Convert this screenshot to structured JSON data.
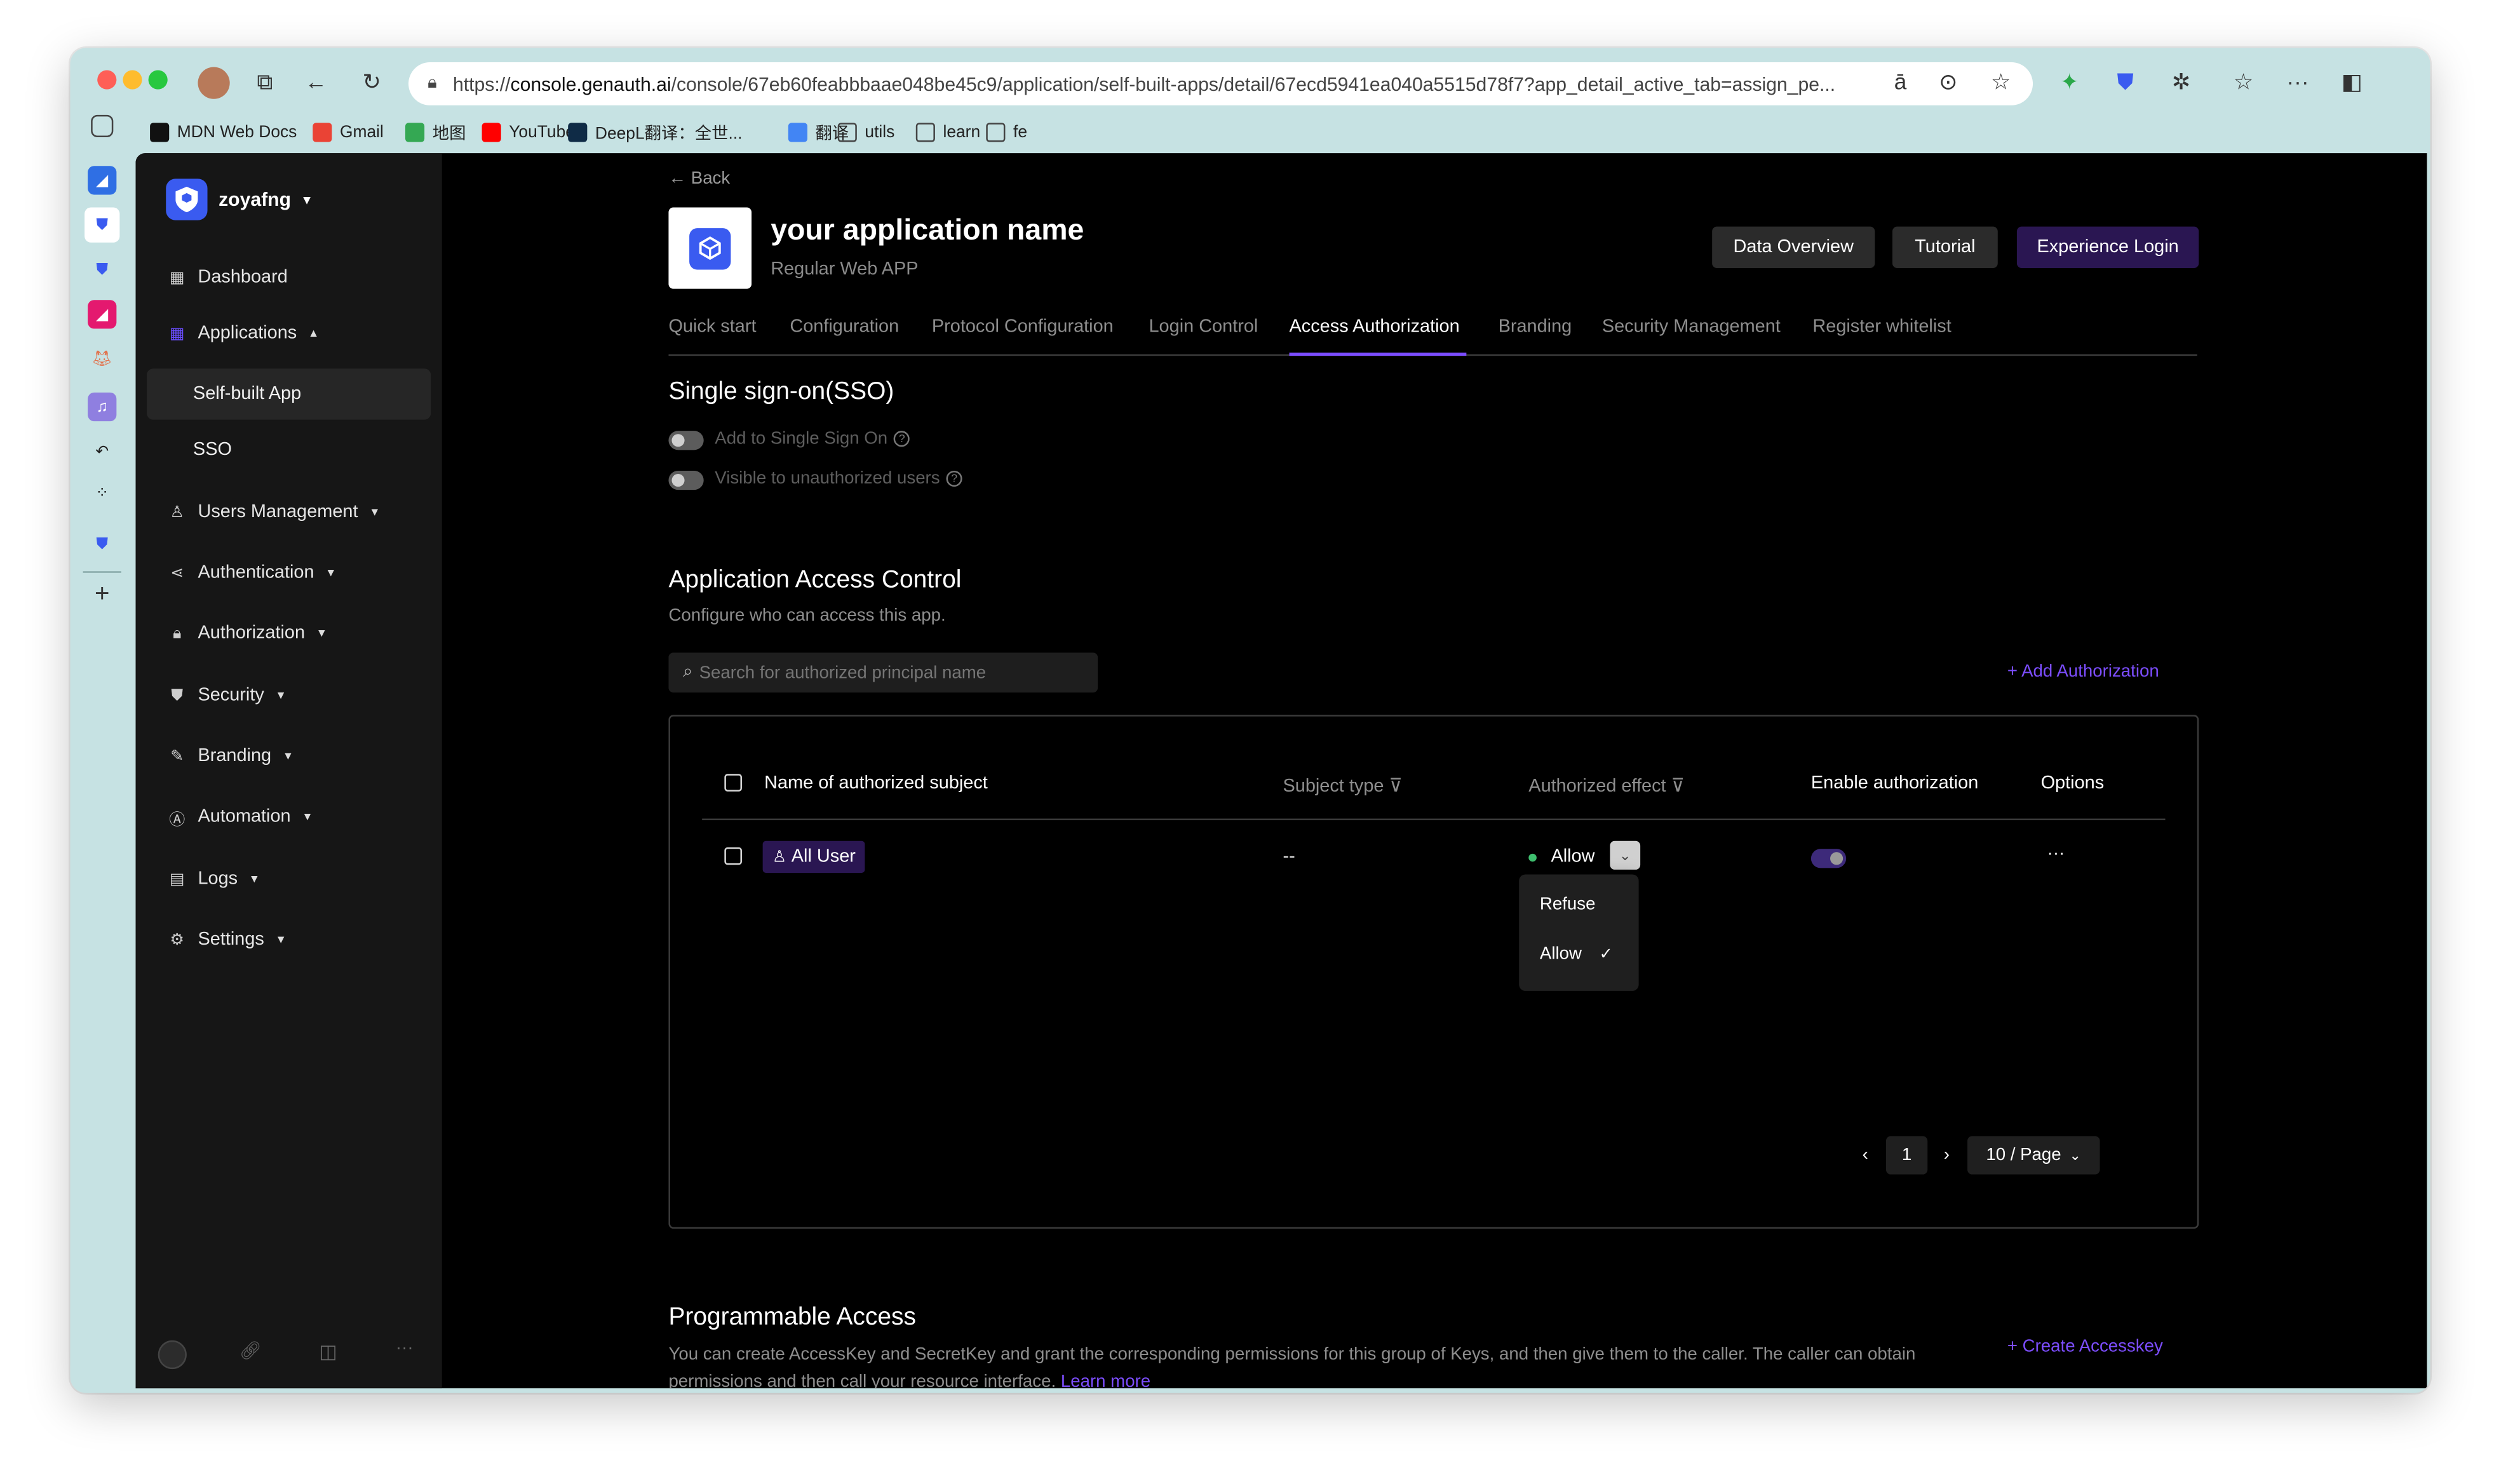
{
  "browser": {
    "url_prefix": "https://",
    "url_domain": "console.genauth.ai",
    "url_rest": "/console/67eb60feabbbaae048be45c9/application/self-built-apps/detail/67ecd5941ea040a5515d78f7?app_detail_active_tab=assign_pe...",
    "bookmarks": [
      {
        "label": "MDN Web Docs",
        "icon": "mdn-icon",
        "color": "#111111"
      },
      {
        "label": "Gmail",
        "icon": "gmail-icon",
        "color": "#ea4335"
      },
      {
        "label": "地图",
        "icon": "maps-icon",
        "color": "#34a853"
      },
      {
        "label": "YouTube",
        "icon": "youtube-icon",
        "color": "#ff0000"
      },
      {
        "label": "DeepL翻译：全世...",
        "icon": "deepl-icon",
        "color": "#0f2b46"
      },
      {
        "label": "翻译",
        "icon": "translate-icon",
        "color": "#4285f4"
      },
      {
        "label": "utils",
        "icon": "folder-icon",
        "color": "#444444"
      },
      {
        "label": "learn",
        "icon": "folder-icon",
        "color": "#444444"
      },
      {
        "label": "fe",
        "icon": "folder-icon",
        "color": "#444444"
      }
    ]
  },
  "sidebar": {
    "workspace": "zoyafng",
    "items": [
      {
        "label": "Dashboard",
        "icon": "dashboard-icon"
      },
      {
        "label": "Applications",
        "icon": "applications-icon",
        "expanded": true
      },
      {
        "label": "Users Management",
        "icon": "user-icon"
      },
      {
        "label": "Authentication",
        "icon": "share-icon"
      },
      {
        "label": "Authorization",
        "icon": "lock-icon"
      },
      {
        "label": "Security",
        "icon": "shield-icon"
      },
      {
        "label": "Branding",
        "icon": "brush-icon"
      },
      {
        "label": "Automation",
        "icon": "automation-icon"
      },
      {
        "label": "Logs",
        "icon": "logs-icon"
      },
      {
        "label": "Settings",
        "icon": "gear-icon"
      }
    ],
    "sub_items": [
      "Self-built App",
      "SSO"
    ]
  },
  "header": {
    "back": "Back",
    "app_name": "your application name",
    "app_type": "Regular Web APP",
    "buttons": {
      "data_overview": "Data Overview",
      "tutorial": "Tutorial",
      "experience_login": "Experience Login"
    }
  },
  "tabs": [
    "Quick start",
    "Configuration",
    "Protocol Configuration",
    "Login Control",
    "Access Authorization",
    "Branding",
    "Security Management",
    "Register whitelist"
  ],
  "active_tab": "Access Authorization",
  "sso": {
    "title": "Single sign-on(SSO)",
    "toggle1": "Add to Single Sign On",
    "toggle2": "Visible to unauthorized users"
  },
  "access": {
    "title": "Application Access Control",
    "subtitle": "Configure who can access this app.",
    "search_placeholder": "Search for authorized principal name",
    "add_label": "+ Add Authorization",
    "columns": {
      "name": "Name of authorized subject",
      "type": "Subject type",
      "effect": "Authorized effect",
      "enable": "Enable authorization",
      "options": "Options"
    },
    "row": {
      "subject": "All User",
      "type": "--",
      "effect": "Allow",
      "enabled": true,
      "options": "···"
    },
    "dropdown": [
      "Refuse",
      "Allow"
    ],
    "selected_option": "Allow",
    "pagination": {
      "prev": "‹",
      "page": "1",
      "next": "›",
      "page_size": "10 / Page"
    }
  },
  "programmable": {
    "title": "Programmable Access",
    "desc": "You can create AccessKey and SecretKey and grant the corresponding permissions for this group of Keys, and then give them to the caller. The caller can obtain permissions and then call your resource interface.",
    "learn_more": "Learn more",
    "create": "+ Create Accesskey"
  },
  "colors": {
    "accent": "#7c4dff",
    "accent_bg": "#2a1652",
    "brand_blue": "#3a5bf0",
    "allow_green": "#3fbf6f"
  }
}
